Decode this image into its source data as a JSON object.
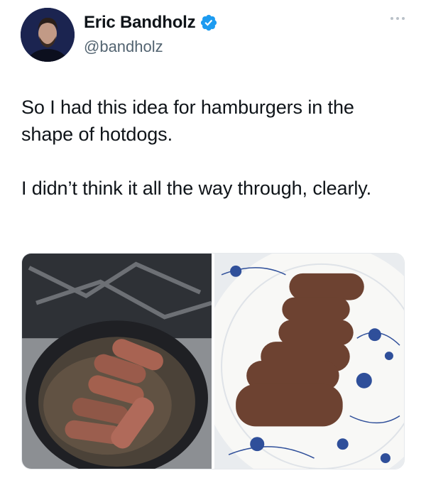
{
  "author": {
    "name": "Eric Bandholz",
    "handle": "@bandholz",
    "verified": true,
    "avatar_icon": "profile-photo",
    "verified_icon": "verified-badge-icon"
  },
  "menu_icon": "more-options-icon",
  "tweet": {
    "text": "So I had this idea for hamburgers in the shape of hotdogs.\n\nI didn’t think it all the way through, clearly."
  },
  "media": [
    {
      "icon": "photo-pan-icon",
      "subject": "hot-dog shaped burgers cooking in cast iron skillet"
    },
    {
      "icon": "photo-plate-icon",
      "subject": "cooked hot-dog shaped burgers on blue and white plate"
    }
  ],
  "colors": {
    "text": "#0f1419",
    "secondary": "#536471",
    "verified": "#1d9bf0"
  }
}
